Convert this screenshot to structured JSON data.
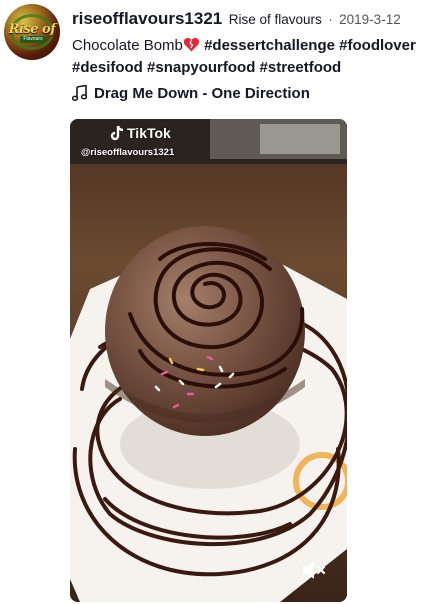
{
  "post": {
    "username": "riseofflavours1321",
    "nickname": "Rise of flavours",
    "separator": "·",
    "date": "2019-3-12",
    "caption_text": "Chocolate Bomb",
    "hashtags": [
      "#dessertchallenge",
      "#foodlover",
      "#desifood",
      "#snapyourfood",
      "#streetfood"
    ],
    "music_title": "Drag Me Down - One Direction"
  },
  "avatar": {
    "logo_text": "Rise of",
    "badge_text": "Flavours"
  },
  "video": {
    "watermark_brand": "TikTok",
    "watermark_handle": "@riseofflavours1321"
  },
  "icons": {
    "heart": "broken-heart-icon",
    "music": "music-note-icon",
    "mute": "speaker-muted-icon",
    "tiktok": "tiktok-logo-icon"
  },
  "colors": {
    "text": "#161823",
    "secondary_text": "#555555",
    "heart": "#e8263a"
  }
}
